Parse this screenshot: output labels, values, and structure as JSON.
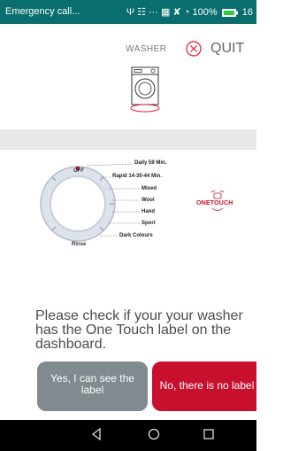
{
  "status_bar": {
    "notification_text": "Emergency call...",
    "icons_text": "Ψ ☷ ··· ▦ ✘ ◔",
    "battery_pct": "100%",
    "time": "16"
  },
  "header": {
    "appliance_label": "WASHER",
    "quit_label": "QUIT"
  },
  "dial": {
    "top_label": "OFF",
    "bottom_left_label": "Rinse",
    "programs": [
      "Daily 59 Min.",
      "Rapid 14-30-44 Min.",
      "Mixed",
      "Wool",
      "Hand",
      "Sport",
      "Dark Colours"
    ],
    "brand_logo_text": "ONETOUCH"
  },
  "prompt": {
    "text": "Please check if your your washer has the One Touch label on the dashboard."
  },
  "buttons": {
    "yes_label": "Yes, I can see the label",
    "no_label": "No, there is no label"
  },
  "colors": {
    "status_bar": "#0a6e6e",
    "accent_red": "#c8102e",
    "gray_button": "#808a8f",
    "nav_bar": "#000000"
  }
}
